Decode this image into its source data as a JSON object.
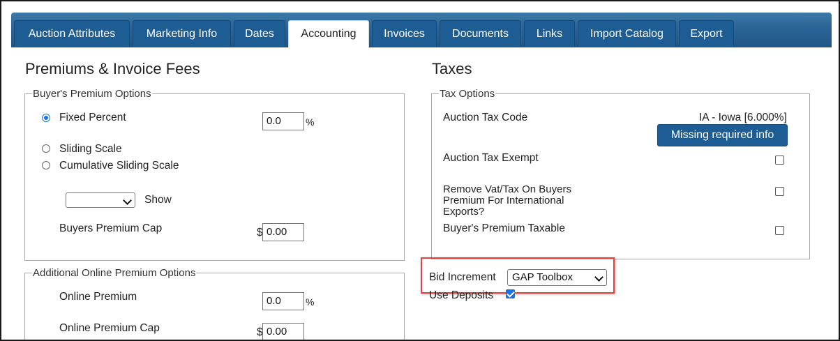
{
  "tabs": [
    {
      "label": "Auction Attributes"
    },
    {
      "label": "Marketing Info"
    },
    {
      "label": "Dates"
    },
    {
      "label": "Accounting"
    },
    {
      "label": "Invoices"
    },
    {
      "label": "Documents"
    },
    {
      "label": "Links"
    },
    {
      "label": "Import Catalog"
    },
    {
      "label": "Export"
    }
  ],
  "active_tab": "Accounting",
  "premiums": {
    "title": "Premiums & Invoice Fees",
    "buyers_premium": {
      "legend": "Buyer's Premium Options",
      "fixed_percent_label": "Fixed Percent",
      "fixed_percent_value": "0.0",
      "percent_sign": "%",
      "sliding_scale_label": "Sliding Scale",
      "cumulative_label": "Cumulative Sliding Scale",
      "show_label": "Show",
      "cap_label": "Buyers Premium Cap",
      "currency_sign": "$",
      "cap_value": "0.00"
    },
    "online": {
      "legend": "Additional Online Premium Options",
      "premium_label": "Online Premium",
      "premium_value": "0.0",
      "percent_sign": "%",
      "cap_label": "Online Premium Cap",
      "currency_sign": "$",
      "cap_value": "0.00"
    }
  },
  "taxes": {
    "title": "Taxes",
    "legend": "Tax Options",
    "tax_code_label": "Auction Tax Code",
    "tax_code_value": "IA - Iowa [6.000%]",
    "missing_button": "Missing required info",
    "exempt_label": "Auction Tax Exempt",
    "remove_vat_line1": "Remove Vat/Tax On Buyers",
    "remove_vat_line2": "Premium For International",
    "remove_vat_line3": "Exports?",
    "premium_taxable_label": "Buyer's Premium Taxable"
  },
  "bid_increment": {
    "label": "Bid Increment",
    "selected": "GAP Toolbox"
  },
  "deposits": {
    "label": "Use Deposits",
    "checked": true
  }
}
